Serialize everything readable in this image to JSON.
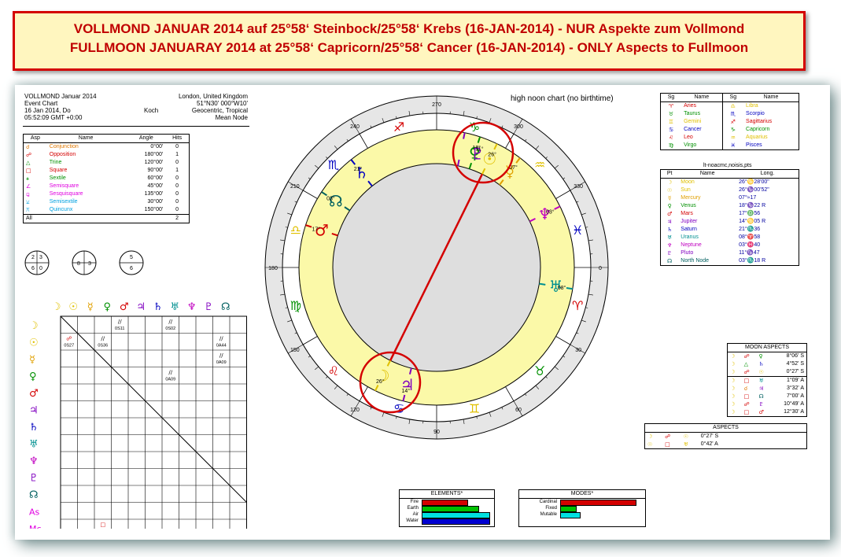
{
  "banner": {
    "line1": "VOLLMOND JANUAR 2014 auf 25°58‘ Steinbock/25°58‘ Krebs (16-JAN-2014) - NUR Aspekte zum Vollmond",
    "line2": "FULLMOON JANUARAY 2014 at 25°58‘ Capricorn/25°58‘ Cancer (16-JAN-2014) - ONLY Aspects to Fullmoon"
  },
  "header": {
    "title": "VOLLMOND Januar 2014",
    "type": "Event Chart",
    "date": "16 Jan 2014, Do",
    "time": "05:52:09 GMT +0:00",
    "house": "Koch",
    "place": "London, United Kingdom",
    "coords": "51°N30' 000°W10'",
    "zodiac": "Geocentric, Tropical",
    "node": "Mean Node",
    "chart_note": "high noon chart (no birthtime)"
  },
  "asp_table": {
    "headers": [
      "Asp",
      "Name",
      "Angle",
      "Hits"
    ],
    "rows": [
      {
        "g": "☌",
        "c": "#e07800",
        "name": "Conjunction",
        "angle": "0°00'",
        "hits": "0"
      },
      {
        "g": "☍",
        "c": "#d40000",
        "name": "Opposition",
        "angle": "180°00'",
        "hits": "1"
      },
      {
        "g": "△",
        "c": "#009000",
        "name": "Trine",
        "angle": "120°00'",
        "hits": "0"
      },
      {
        "g": "□",
        "c": "#d40000",
        "name": "Square",
        "angle": "90°00'",
        "hits": "1"
      },
      {
        "g": "⚹",
        "c": "#009000",
        "name": "Sextile",
        "angle": "60°00'",
        "hits": "0"
      },
      {
        "g": "∠",
        "c": "#e000e0",
        "name": "Semisquare",
        "angle": "45°00'",
        "hits": "0"
      },
      {
        "g": "⚼",
        "c": "#e000e0",
        "name": "Sesquisquare",
        "angle": "135°00'",
        "hits": "0"
      },
      {
        "g": "⚺",
        "c": "#00a0e0",
        "name": "Semisextile",
        "angle": "30°00'",
        "hits": "0"
      },
      {
        "g": "⚻",
        "c": "#00a0e0",
        "name": "Quincunx",
        "angle": "150°00'",
        "hits": "0"
      }
    ],
    "all_label": "All",
    "all_hits": "2"
  },
  "mini_circles": [
    {
      "a": "2",
      "b": "3",
      "c": "6",
      "d": "0"
    },
    {
      "a": "8",
      "b": "3",
      "c": "0",
      "d": ""
    },
    {
      "a": "5",
      "b": "6",
      "c": "",
      "d": ""
    }
  ],
  "signs_table": {
    "headers": [
      "Sg",
      "Name",
      "Sg",
      "Name"
    ],
    "rows": [
      {
        "g1": "♈",
        "c1": "#d40000",
        "n1": "Aries",
        "g2": "♎",
        "c2": "#e0c000",
        "n2": "Libra"
      },
      {
        "g1": "♉",
        "c1": "#009000",
        "n1": "Taurus",
        "g2": "♏",
        "c2": "#0000c0",
        "n2": "Scorpio"
      },
      {
        "g1": "♊",
        "c1": "#e0c000",
        "n1": "Gemini",
        "g2": "♐",
        "c2": "#d40000",
        "n2": "Sagittarius"
      },
      {
        "g1": "♋",
        "c1": "#0000c0",
        "n1": "Cancer",
        "g2": "♑",
        "c2": "#009000",
        "n2": "Capricorn"
      },
      {
        "g1": "♌",
        "c1": "#d40000",
        "n1": "Leo",
        "g2": "♒",
        "c2": "#e0c000",
        "n2": "Aquarius"
      },
      {
        "g1": "♍",
        "c1": "#009000",
        "n1": "Virgo",
        "g2": "♓",
        "c2": "#0000c0",
        "n2": "Pisces"
      }
    ]
  },
  "planets_table": {
    "caption": "lt-noacmc,noisis,pts",
    "headers": [
      "Pt",
      "Name",
      "Long."
    ],
    "rows": [
      {
        "g": "☽",
        "c": "#e0c000",
        "name": "Moon",
        "long": "26°♋28'00\""
      },
      {
        "g": "☉",
        "c": "#e0c000",
        "name": "Sun",
        "long": "26°♑00'52\""
      },
      {
        "g": "☿",
        "c": "#e0a000",
        "name": "Mercury",
        "long": "07°≈17"
      },
      {
        "g": "♀",
        "c": "#009000",
        "name": "Venus",
        "long": "18°♑22 R"
      },
      {
        "g": "♂",
        "c": "#d40000",
        "name": "Mars",
        "long": "17°♎56"
      },
      {
        "g": "♃",
        "c": "#8000c0",
        "name": "Jupiter",
        "long": "14°♋05 R"
      },
      {
        "g": "♄",
        "c": "#0000c0",
        "name": "Saturn",
        "long": "21°♏36"
      },
      {
        "g": "♅",
        "c": "#009090",
        "name": "Uranus",
        "long": "08°♈58"
      },
      {
        "g": "♆",
        "c": "#c000c0",
        "name": "Neptune",
        "long": "03°♓40"
      },
      {
        "g": "♇",
        "c": "#8000c0",
        "name": "Pluto",
        "long": "11°♑47"
      },
      {
        "g": "☊",
        "c": "#006060",
        "name": "North Node",
        "long": "03°♏18 R"
      }
    ]
  },
  "moon_aspects": {
    "title": "MOON ASPECTS",
    "rows": [
      {
        "p1": "☽",
        "a": "☍",
        "p2": "♀",
        "v": "8°06' S",
        "ac": "#d40000",
        "pc": "#009000"
      },
      {
        "p1": "☽",
        "a": "△",
        "p2": "♄",
        "v": "4°52' S",
        "ac": "#009000",
        "pc": "#0000c0"
      },
      {
        "p1": "☽",
        "a": "☍",
        "p2": "☉",
        "v": "0°27' S",
        "ac": "#d40000",
        "pc": "#e0c000"
      },
      {
        "p1": "☽",
        "a": "□",
        "p2": "♅",
        "v": "1°09' A",
        "ac": "#d40000",
        "pc": "#009090"
      },
      {
        "p1": "☽",
        "a": "☌",
        "p2": "♃",
        "v": "3°32' A",
        "ac": "#e07800",
        "pc": "#8000c0"
      },
      {
        "p1": "☽",
        "a": "□",
        "p2": "☊",
        "v": "7°00' A",
        "ac": "#d40000",
        "pc": "#006060"
      },
      {
        "p1": "☽",
        "a": "☍",
        "p2": "♇",
        "v": "10°49' A",
        "ac": "#d40000",
        "pc": "#8000c0"
      },
      {
        "p1": "☽",
        "a": "□",
        "p2": "♂",
        "v": "12°30' A",
        "ac": "#d40000",
        "pc": "#d40000"
      }
    ]
  },
  "aspects": {
    "title": "ASPECTS",
    "rows": [
      {
        "p1": "☽",
        "a": "☍",
        "p2": "☉",
        "v": "0°27' S",
        "ac": "#d40000"
      },
      {
        "p1": "☉",
        "a": "□",
        "p2": "♅",
        "v": "0°42' A",
        "ac": "#d40000"
      }
    ]
  },
  "elements": {
    "title": "ELEMENTS*",
    "rows": [
      {
        "label": "Fire",
        "value": 4,
        "color": "#d40000"
      },
      {
        "label": "Earth",
        "value": 5,
        "color": "#00c000"
      },
      {
        "label": "Air",
        "value": 6,
        "color": "#00e0e0"
      },
      {
        "label": "Water",
        "value": 6,
        "color": "#0000d0"
      }
    ],
    "max": 6
  },
  "modes": {
    "title": "MODES*",
    "rows": [
      {
        "label": "Cardinal",
        "value": 10,
        "color": "#d40000"
      },
      {
        "label": "Fixed",
        "value": 2,
        "color": "#00c000"
      },
      {
        "label": "Mutable",
        "value": 2.5,
        "color": "#00e0e0"
      }
    ],
    "max": 10
  },
  "grid": {
    "cols": [
      {
        "g": "☽",
        "c": "#e0c000"
      },
      {
        "g": "☉",
        "c": "#e0c000"
      },
      {
        "g": "☿",
        "c": "#e0a000"
      },
      {
        "g": "♀",
        "c": "#009000"
      },
      {
        "g": "♂",
        "c": "#d40000"
      },
      {
        "g": "♃",
        "c": "#8000c0"
      },
      {
        "g": "♄",
        "c": "#0000c0"
      },
      {
        "g": "♅",
        "c": "#009090"
      },
      {
        "g": "♆",
        "c": "#c000c0"
      },
      {
        "g": "♇",
        "c": "#8000c0"
      },
      {
        "g": "☊",
        "c": "#006060"
      }
    ],
    "rows": [
      {
        "g": "☽",
        "c": "#e0c000"
      },
      {
        "g": "☉",
        "c": "#e0c000"
      },
      {
        "g": "☿",
        "c": "#e0a000"
      },
      {
        "g": "♀",
        "c": "#009000"
      },
      {
        "g": "♂",
        "c": "#d40000"
      },
      {
        "g": "♃",
        "c": "#8000c0"
      },
      {
        "g": "♄",
        "c": "#0000c0"
      },
      {
        "g": "♅",
        "c": "#009090"
      },
      {
        "g": "♆",
        "c": "#c000c0"
      },
      {
        "g": "♇",
        "c": "#8000c0"
      },
      {
        "g": "☊",
        "c": "#006060"
      },
      {
        "g": "As",
        "c": "#e000e0"
      },
      {
        "g": "Mc",
        "c": "#e000e0"
      }
    ],
    "cells": [
      {
        "r": 0,
        "col": 3,
        "sym": "//",
        "val": "0S11"
      },
      {
        "r": 0,
        "col": 6,
        "sym": "//",
        "val": "0S02"
      },
      {
        "r": 1,
        "col": 0,
        "sym": "☍",
        "val": "0S27",
        "sc": "#d40000"
      },
      {
        "r": 1,
        "col": 2,
        "sym": "//",
        "val": "0S36"
      },
      {
        "r": 1,
        "col": 9,
        "sym": "//",
        "val": "0A44"
      },
      {
        "r": 2,
        "col": 9,
        "sym": "//",
        "val": "0A09"
      },
      {
        "r": 3,
        "col": 6,
        "sym": "//",
        "val": "0A09"
      },
      {
        "r": 12,
        "col": 2,
        "sym": "□",
        "val": "0A42",
        "sc": "#d40000"
      }
    ]
  },
  "wheel": {
    "degree_labels": [
      "270",
      "240",
      "210",
      "180",
      "150",
      "120",
      "90",
      "60",
      "30",
      "0",
      "330",
      "300"
    ],
    "signs": [
      {
        "g": "♈",
        "c": "#d40000"
      },
      {
        "g": "♉",
        "c": "#009000"
      },
      {
        "g": "♊",
        "c": "#e0c000"
      },
      {
        "g": "♋",
        "c": "#0000c0"
      },
      {
        "g": "♌",
        "c": "#d40000"
      },
      {
        "g": "♍",
        "c": "#009000"
      },
      {
        "g": "♎",
        "c": "#e0c000"
      },
      {
        "g": "♏",
        "c": "#0000c0"
      },
      {
        "g": "♐",
        "c": "#d40000"
      },
      {
        "g": "♑",
        "c": "#009000"
      },
      {
        "g": "♒",
        "c": "#e0c000"
      },
      {
        "g": "♓",
        "c": "#0000c0"
      }
    ],
    "planets": [
      {
        "name": "Moon",
        "g": "☽",
        "c": "#e0c000",
        "lon": 116.47,
        "deg": "26°"
      },
      {
        "name": "Sun",
        "g": "☉",
        "c": "#e0c000",
        "lon": 296.01,
        "deg": "26°"
      },
      {
        "name": "Mercury",
        "g": "☿",
        "c": "#e0a000",
        "lon": 307.28,
        "deg": "07°"
      },
      {
        "name": "Venus",
        "g": "♀",
        "c": "#009000",
        "lon": 288.37,
        "deg": "18°"
      },
      {
        "name": "Mars",
        "g": "♂",
        "c": "#d40000",
        "lon": 197.93,
        "deg": "17°"
      },
      {
        "name": "Jupiter",
        "g": "♃",
        "c": "#8000c0",
        "lon": 104.08,
        "deg": "14°"
      },
      {
        "name": "Saturn",
        "g": "♄",
        "c": "#0000c0",
        "lon": 231.6,
        "deg": "21°"
      },
      {
        "name": "Uranus",
        "g": "♅",
        "c": "#009090",
        "lon": 8.97,
        "deg": "08°"
      },
      {
        "name": "Neptune",
        "g": "♆",
        "c": "#c000c0",
        "lon": 333.67,
        "deg": "03°"
      },
      {
        "name": "Pluto",
        "g": "♇",
        "c": "#8000c0",
        "lon": 281.78,
        "deg": "11°"
      },
      {
        "name": "North Node",
        "g": "☊",
        "c": "#006060",
        "lon": 213.3,
        "deg": "03°"
      }
    ],
    "opposition": {
      "from": 116.47,
      "to": 296.01,
      "color": "#d40000"
    }
  }
}
